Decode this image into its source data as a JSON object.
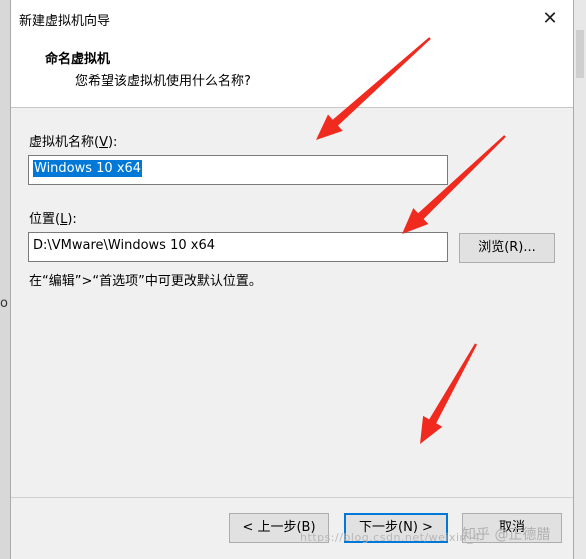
{
  "window": {
    "title": "新建虚拟机向导",
    "close_glyph": "✕"
  },
  "header": {
    "title": "命名虚拟机",
    "subtitle": "您希望该虚拟机使用什么名称?"
  },
  "form": {
    "name_label": "虚拟机名称(",
    "name_key": "V",
    "name_label_end": "):",
    "name_value": "Windows 10 x64",
    "location_label": "位置(",
    "location_key": "L",
    "location_label_end": "):",
    "location_value": "D:\\VMware\\Windows 10 x64",
    "browse_label": "浏览(R)...",
    "hint": "在“编辑”>“首选项”中可更改默认位置。"
  },
  "footer": {
    "back_label": "< 上一步(B)",
    "next_label": "下一步(N) >",
    "cancel_label": "取消"
  },
  "background": {
    "left_fragment": "o"
  },
  "overlay": {
    "watermark": "https://blog.csdn.net/weixin_4",
    "zhihu": "知乎 @正德腊",
    "arrow_color": "#f02a1e"
  }
}
